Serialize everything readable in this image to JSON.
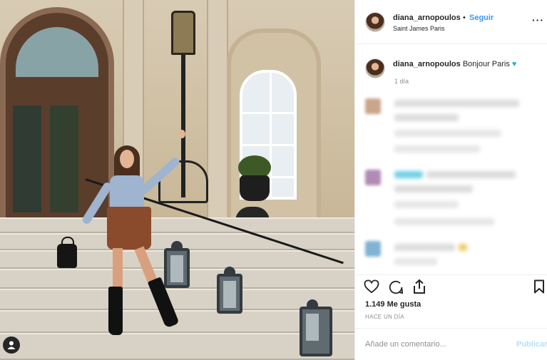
{
  "post": {
    "username": "diana_arnopoulos",
    "separator": "•",
    "follow_label": "Seguir",
    "location": "Saint James Paris",
    "more_label": "···"
  },
  "caption": {
    "username": "diana_arnopoulos",
    "text": "Bonjour Paris",
    "emoji": "♥",
    "time": "1 día"
  },
  "blurred_comments": {
    "avatar_colors": [
      "#c9a58a",
      "#b08bb5",
      "#7fb3d4"
    ],
    "accent_colors": [
      "#6fd0e6",
      "#f2c96b"
    ]
  },
  "actions": {
    "like_icon": "heart-icon",
    "comment_icon": "comment-icon",
    "share_icon": "share-icon",
    "save_icon": "bookmark-icon"
  },
  "stats": {
    "likes": "1.149 Me gusta",
    "posted": "HACE UN DÍA"
  },
  "comment_box": {
    "placeholder": "Añade un comentario...",
    "publish_label": "Publicar"
  },
  "colors": {
    "accent": "#3897f0",
    "publish_disabled": "#b2dffc",
    "heart_emoji": "#1fb4cf"
  }
}
